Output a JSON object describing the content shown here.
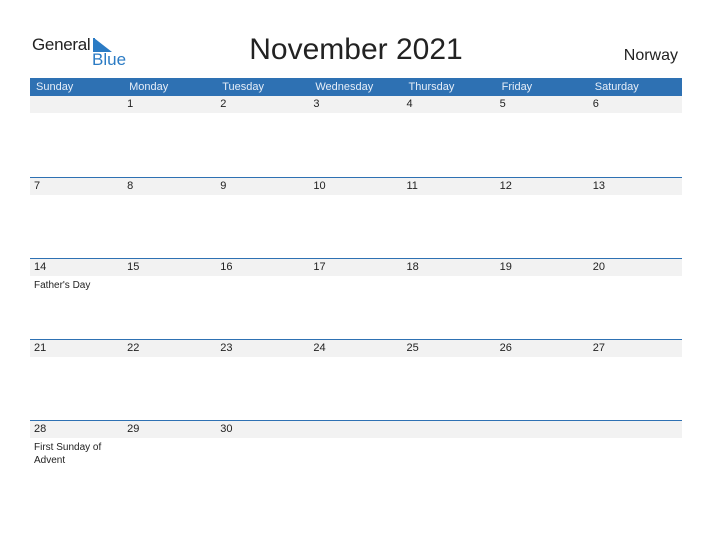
{
  "logo": {
    "line1": "General",
    "line2": "Blue"
  },
  "title": "November 2021",
  "country": "Norway",
  "colors": {
    "header_bg": "#2e71b3",
    "accent": "#2b7bc4",
    "date_strip": "#f2f2f2"
  },
  "weekdays": [
    "Sunday",
    "Monday",
    "Tuesday",
    "Wednesday",
    "Thursday",
    "Friday",
    "Saturday"
  ],
  "weeks": [
    {
      "days": [
        "",
        "1",
        "2",
        "3",
        "4",
        "5",
        "6"
      ],
      "events": [
        "",
        "",
        "",
        "",
        "",
        "",
        ""
      ]
    },
    {
      "days": [
        "7",
        "8",
        "9",
        "10",
        "11",
        "12",
        "13"
      ],
      "events": [
        "",
        "",
        "",
        "",
        "",
        "",
        ""
      ]
    },
    {
      "days": [
        "14",
        "15",
        "16",
        "17",
        "18",
        "19",
        "20"
      ],
      "events": [
        "Father's Day",
        "",
        "",
        "",
        "",
        "",
        ""
      ]
    },
    {
      "days": [
        "21",
        "22",
        "23",
        "24",
        "25",
        "26",
        "27"
      ],
      "events": [
        "",
        "",
        "",
        "",
        "",
        "",
        ""
      ]
    },
    {
      "days": [
        "28",
        "29",
        "30",
        "",
        "",
        "",
        ""
      ],
      "events": [
        "First Sunday of Advent",
        "",
        "",
        "",
        "",
        "",
        ""
      ]
    }
  ]
}
